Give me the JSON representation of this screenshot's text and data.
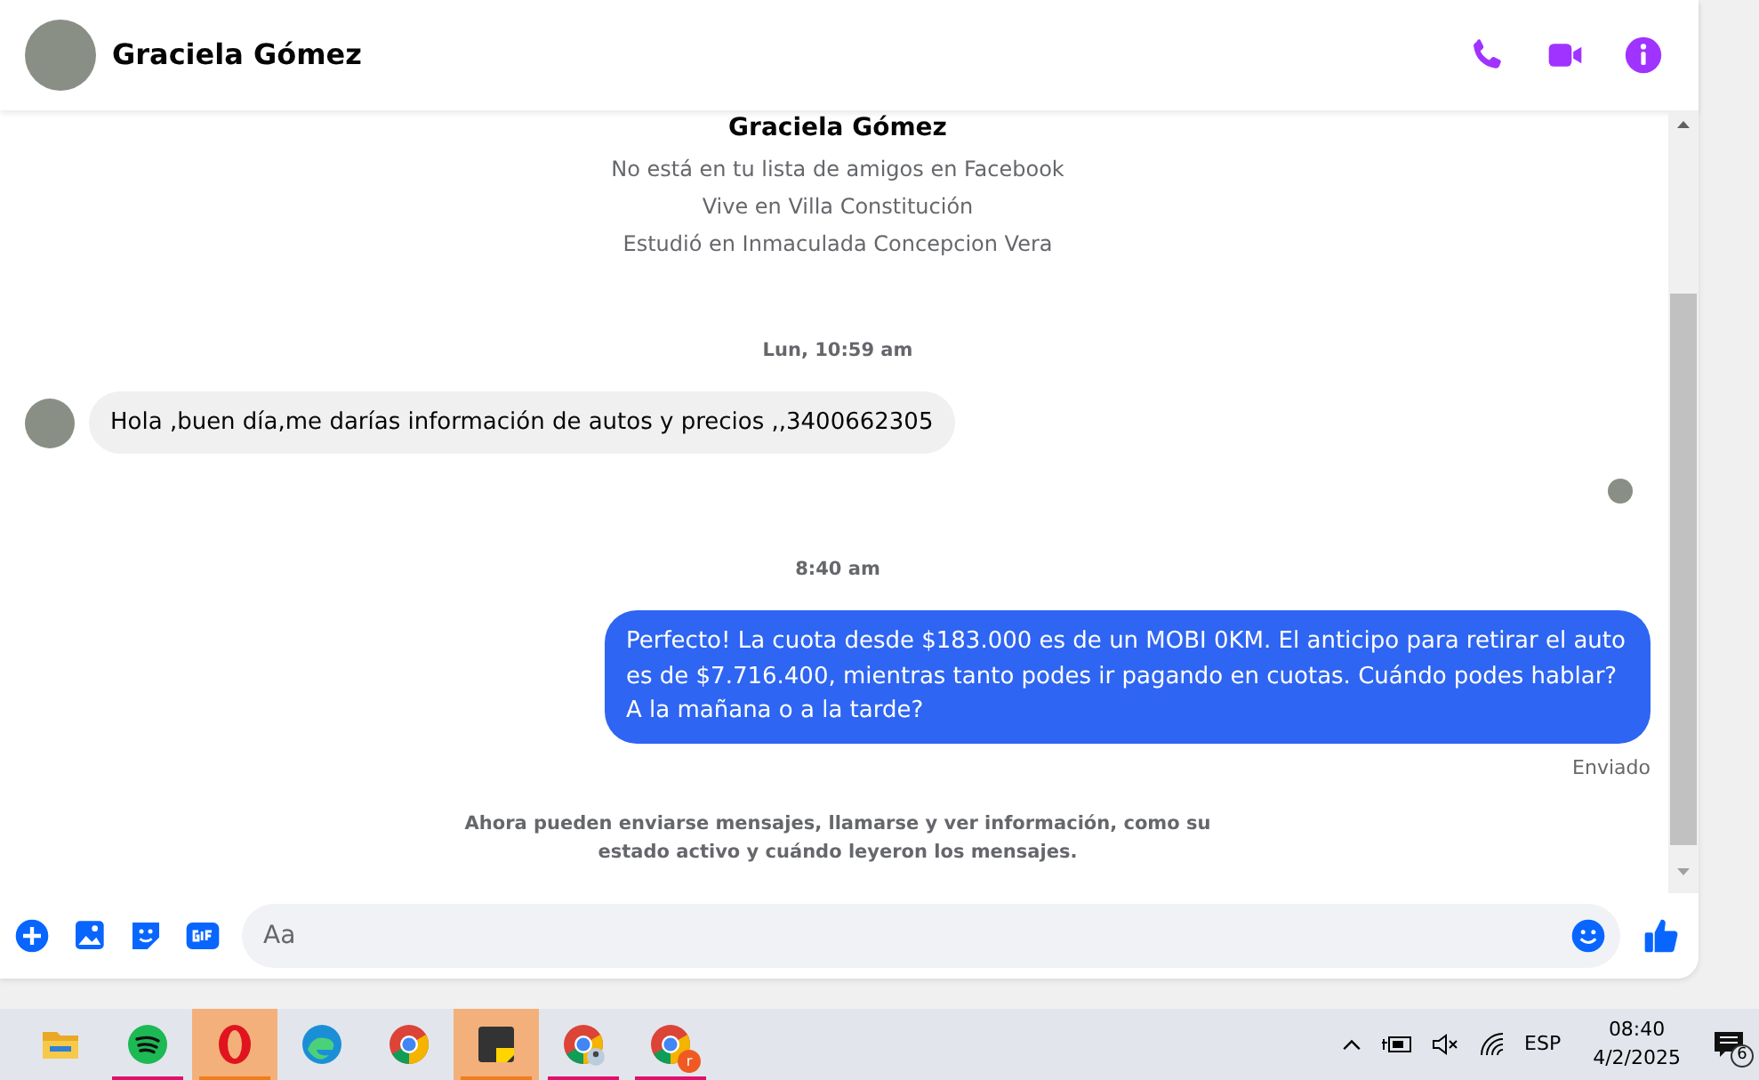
{
  "header": {
    "name": "Graciela Gómez"
  },
  "profile": {
    "name": "Graciela Gómez",
    "lines": [
      "No está en tu lista de amigos en Facebook",
      "Vive en Villa Constitución",
      "Estudió en Inmaculada Concepcion Vera"
    ]
  },
  "messages": [
    {
      "kind": "separator",
      "text": "Lun, 10:59 am"
    },
    {
      "kind": "incoming",
      "text": "Hola ,buen día,me darías información de autos y precios ,,3400662305"
    },
    {
      "kind": "seen"
    },
    {
      "kind": "separator",
      "text": "8:40 am"
    },
    {
      "kind": "outgoing",
      "text": "Perfecto! La cuota desde $183.000 es de un MOBI 0KM. El anticipo para retirar el auto es de $7.716.400, mientras tanto podes ir pagando en cuotas. Cuándo podes hablar? A la mañana o a la tarde?",
      "status": "Enviado"
    },
    {
      "kind": "notice",
      "text": "Ahora pueden enviarse mensajes, llamarse y ver información, como su estado activo y cuándo leyeron los mensajes."
    }
  ],
  "composer": {
    "placeholder": "Aa"
  },
  "taskbar": {
    "apps": [
      {
        "kind": "folder",
        "running": false,
        "highlighted": false
      },
      {
        "kind": "spotify",
        "running": true,
        "highlighted": false
      },
      {
        "kind": "opera",
        "running": true,
        "highlighted": true
      },
      {
        "kind": "edge",
        "running": false,
        "highlighted": false
      },
      {
        "kind": "chrome",
        "running": false,
        "highlighted": false
      },
      {
        "kind": "notes",
        "running": true,
        "highlighted": true
      },
      {
        "kind": "chrome-profile",
        "running": true,
        "highlighted": false
      },
      {
        "kind": "chrome-badge",
        "badge": "r",
        "running": true,
        "highlighted": false
      }
    ],
    "language": "ESP",
    "time": "08:40",
    "date": "4/2/2025",
    "notifications": "6"
  }
}
